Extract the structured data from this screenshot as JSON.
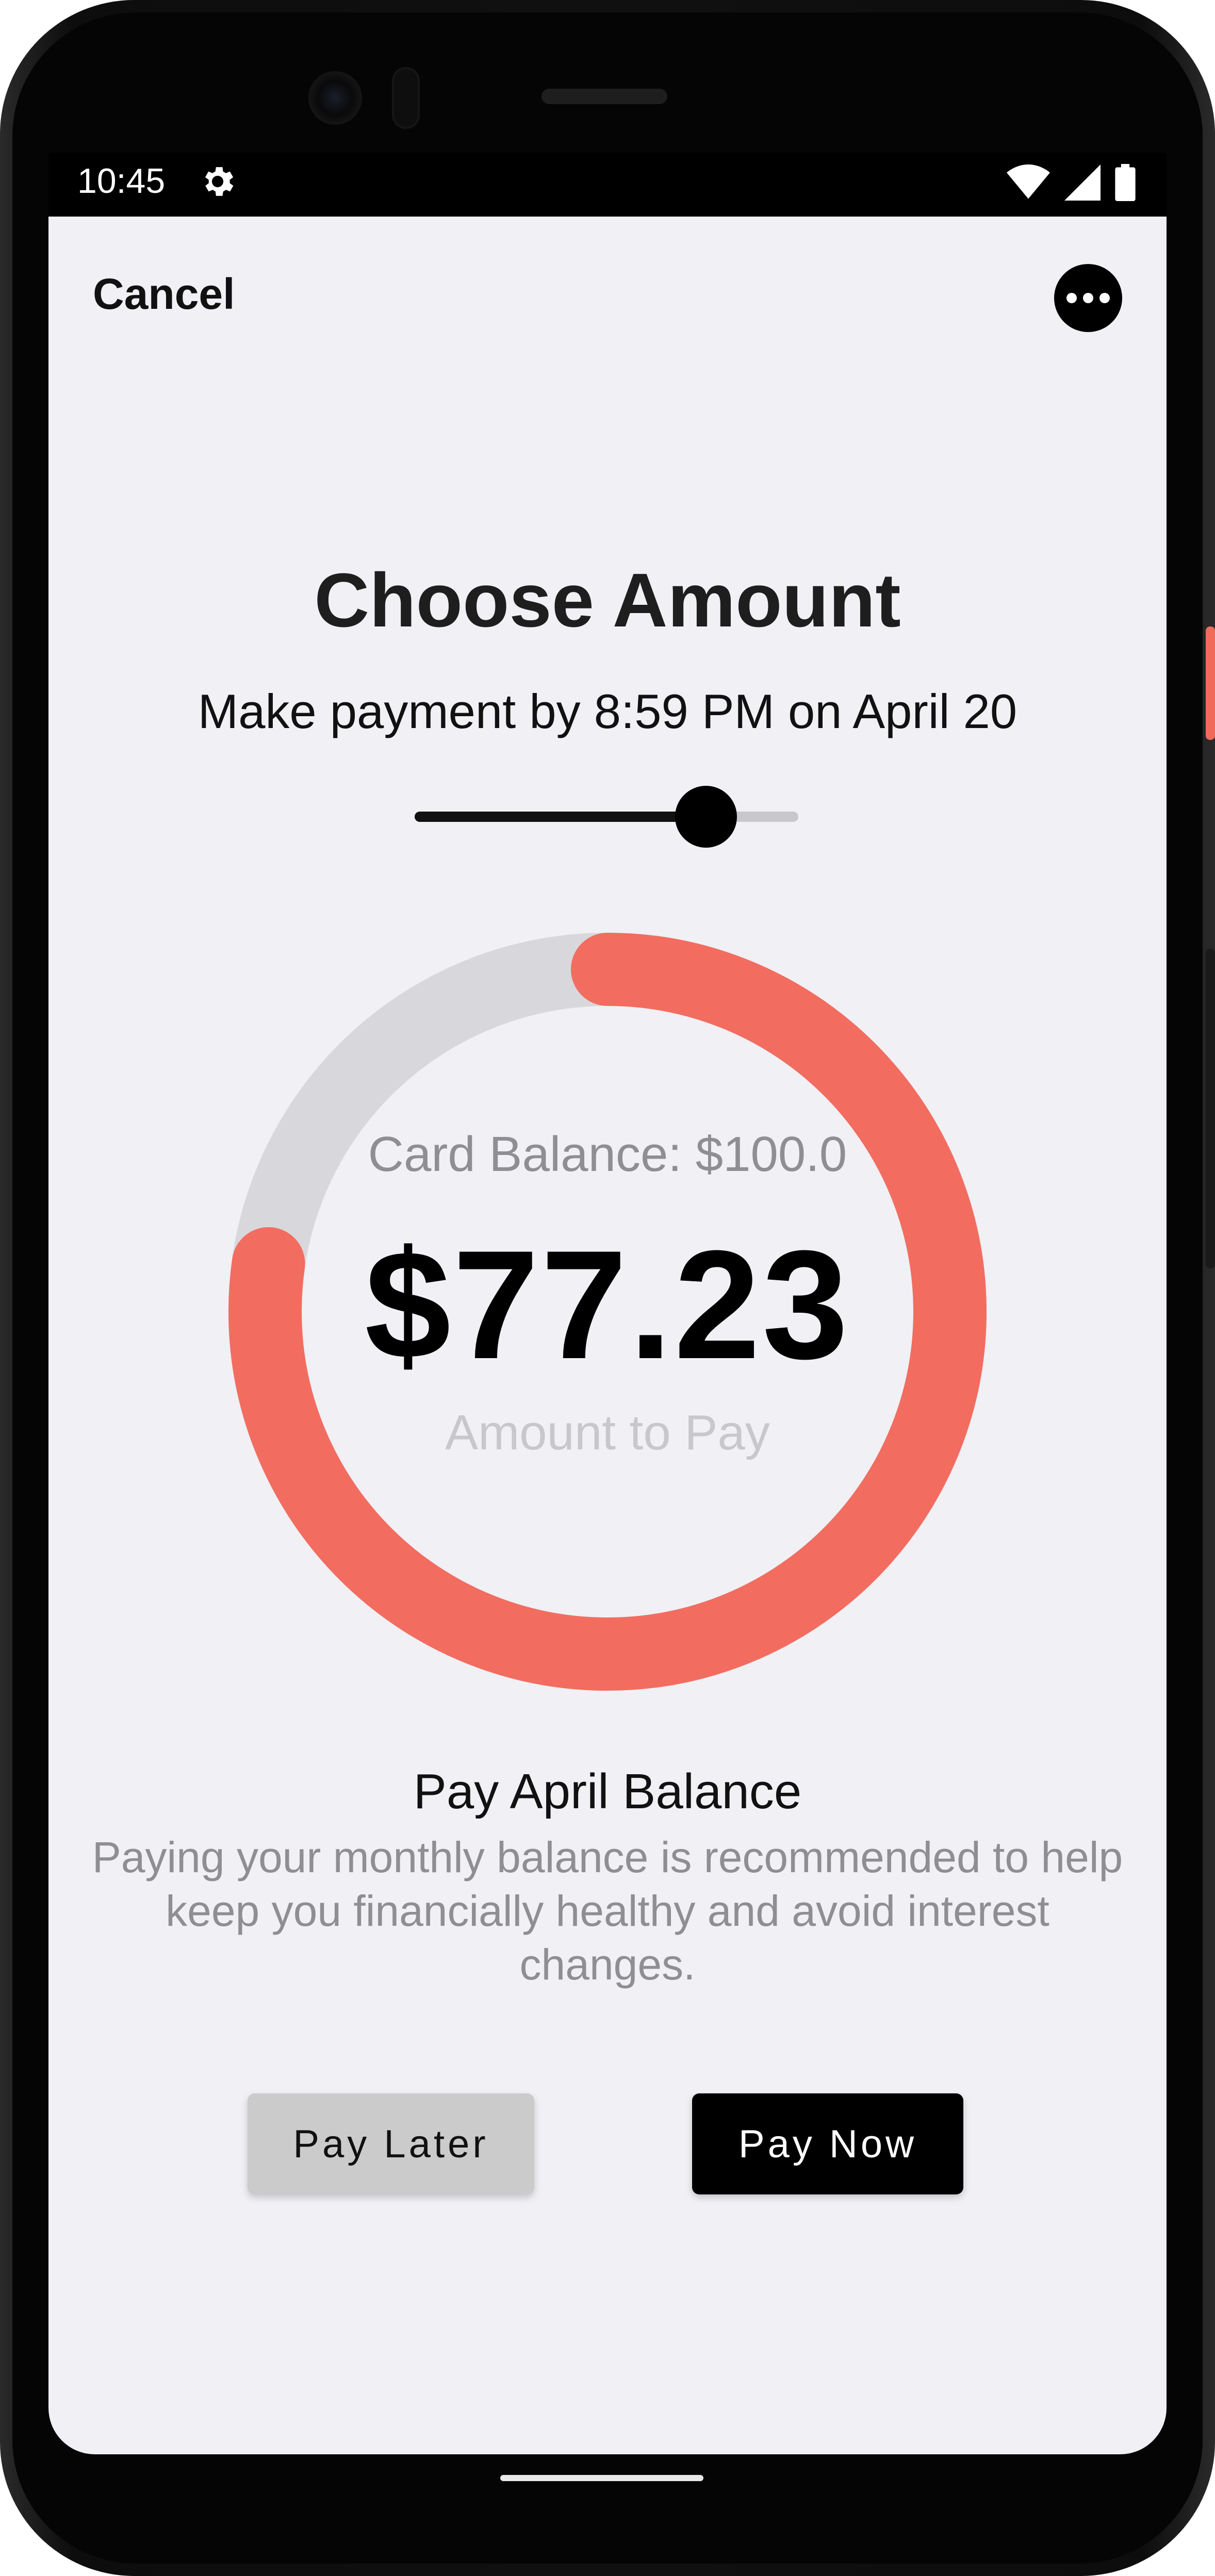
{
  "status_bar": {
    "time": "10:45",
    "icons": [
      "settings-gear-icon",
      "wifi-icon",
      "signal-icon",
      "battery-icon"
    ]
  },
  "header": {
    "cancel_label": "Cancel",
    "more_icon": "more-horizontal-icon"
  },
  "main": {
    "title": "Choose Amount",
    "subtitle": "Make payment by 8:59 PM on April 20",
    "slider_value": 0.76,
    "card_balance": "Card Balance: $100.0",
    "amount": "$77.23",
    "amount_label": "Amount to Pay",
    "progress_fraction": 0.7723
  },
  "info": {
    "title": "Pay April Balance",
    "description": "Paying your monthly balance is recommended to help keep you financially healthy and avoid interest changes."
  },
  "actions": {
    "pay_later_label": "Pay Later",
    "pay_now_label": "Pay Now"
  },
  "colors": {
    "accent": "#f26d60",
    "track": "#d8d8dc",
    "background": "#f0f0f5"
  }
}
